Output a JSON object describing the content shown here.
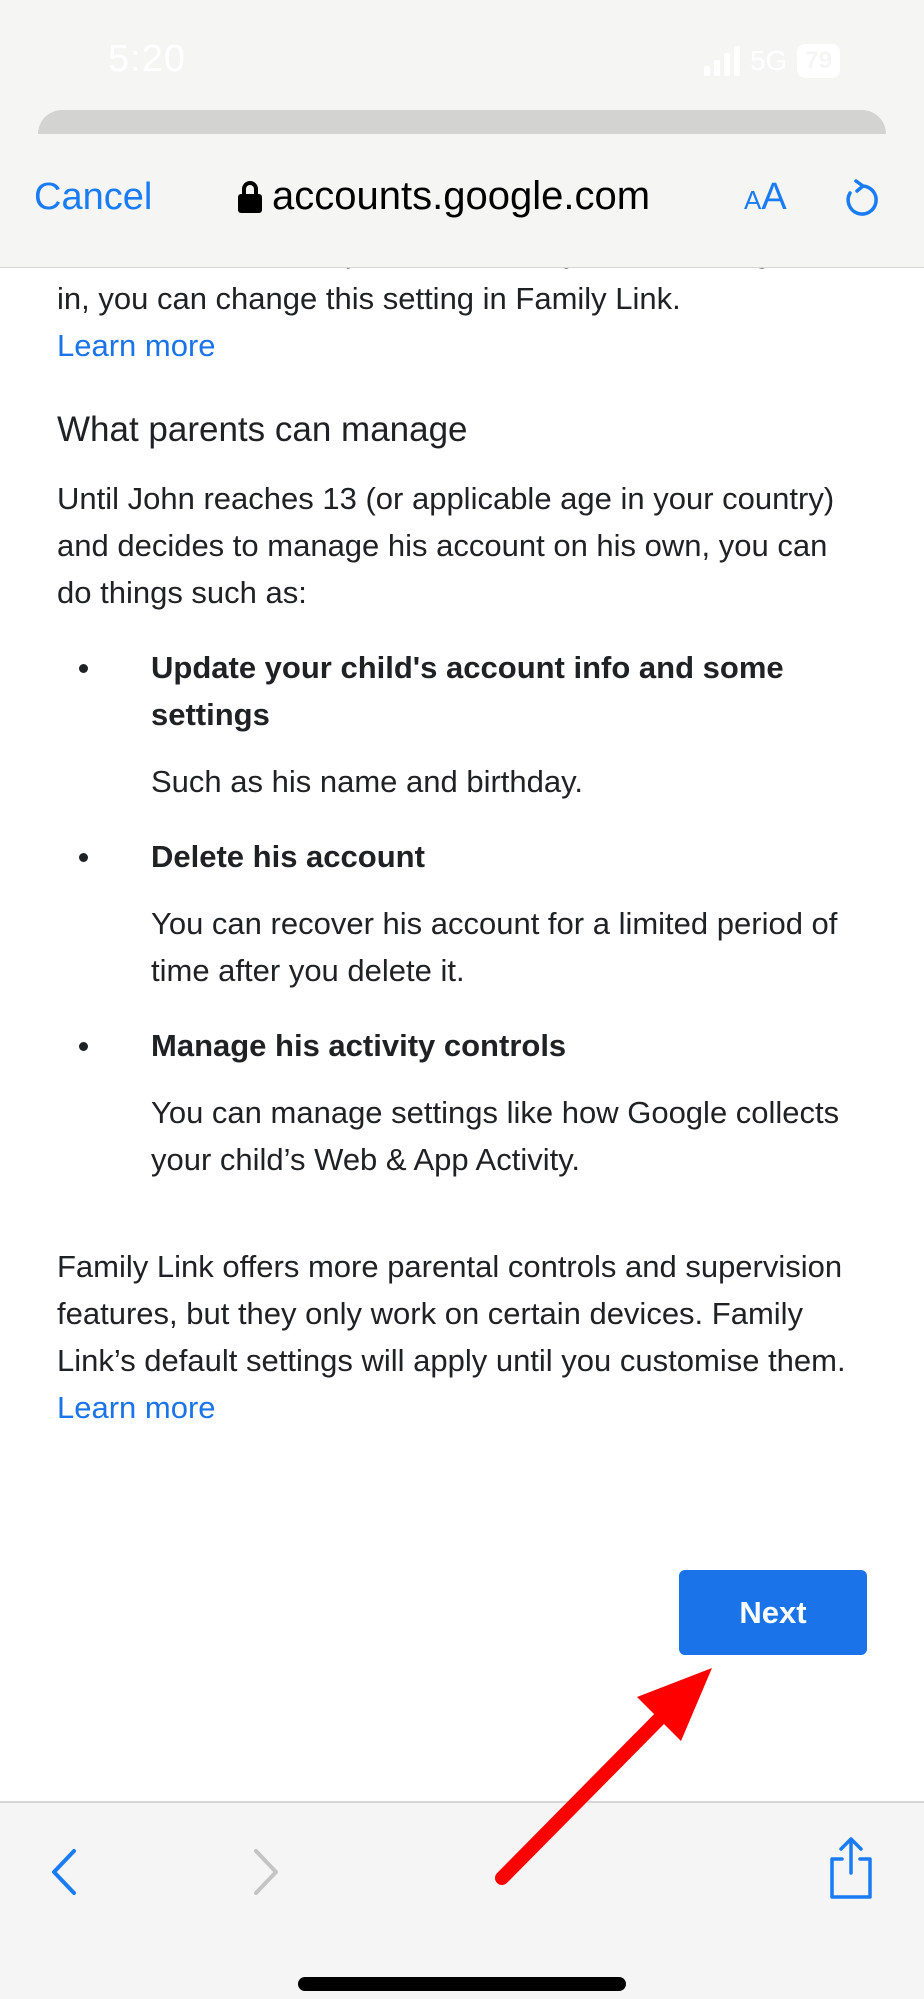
{
  "status_bar": {
    "time": "5:20",
    "network": "5G",
    "battery": "79"
  },
  "browser": {
    "cancel_label": "Cancel",
    "url": "accounts.google.com",
    "text_size_label_small": "A",
    "text_size_label_big": "A",
    "icons": {
      "lock": "lock-icon",
      "reload": "reload-icon",
      "back": "chevron-left-icon",
      "forward": "chevron-right-icon",
      "share": "share-icon"
    }
  },
  "content": {
    "cut_off_line": "want to be asked for permission every time John signs",
    "continuation": "in, you can change this setting in Family Link.",
    "learn_more_1": "Learn more",
    "heading": "What parents can manage",
    "intro": "Until John reaches 13 (or applicable age in your country) and decides to manage his account on his own, you can do things such as:",
    "bullets": [
      {
        "title": "Update your child's account info and some settings",
        "description": "Such as his name and birthday."
      },
      {
        "title": "Delete his account",
        "description": "You can recover his account for a limited period of time after you delete it."
      },
      {
        "title": "Manage his activity controls",
        "description": "You can manage settings like how Google collects your child’s Web & App Activity."
      }
    ],
    "footer_text": "Family Link offers more parental controls and supervision features, but they only work on certain devices. Family Link’s default settings will apply until you customise them.",
    "learn_more_2": "Learn more"
  },
  "actions": {
    "next_label": "Next"
  },
  "colors": {
    "accent": "#1a73e8",
    "ios_blue": "#1a7cf5",
    "annotation": "#ff0000"
  }
}
